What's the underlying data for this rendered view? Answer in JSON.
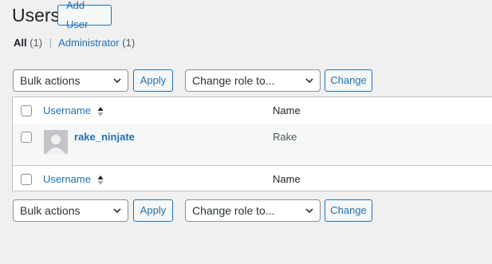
{
  "page": {
    "title": "Users",
    "add_user_label": "Add User"
  },
  "filters": {
    "all_label": "All",
    "all_count": "(1)",
    "separator": "|",
    "admin_label": "Administrator",
    "admin_count": "(1)"
  },
  "top_actions": {
    "bulk_actions": "Bulk actions",
    "apply_label": "Apply",
    "change_role": "Change role to...",
    "change_label": "Change"
  },
  "bottom_actions": {
    "bulk_actions": "Bulk actions",
    "apply_label": "Apply",
    "change_role": "Change role to...",
    "change_label": "Change"
  },
  "table": {
    "columns": [
      "Username",
      "Name"
    ],
    "rows": [
      {
        "username": "rake_ninjate",
        "name": "Rake"
      }
    ]
  },
  "colors": {
    "link": "#2271b1",
    "background": "#f0f0f1",
    "border": "#c3c4c7"
  },
  "icons": {
    "sort": "sort-arrows-icon",
    "avatar": "default-avatar-icon",
    "dropdown": "chevron-down-icon"
  }
}
